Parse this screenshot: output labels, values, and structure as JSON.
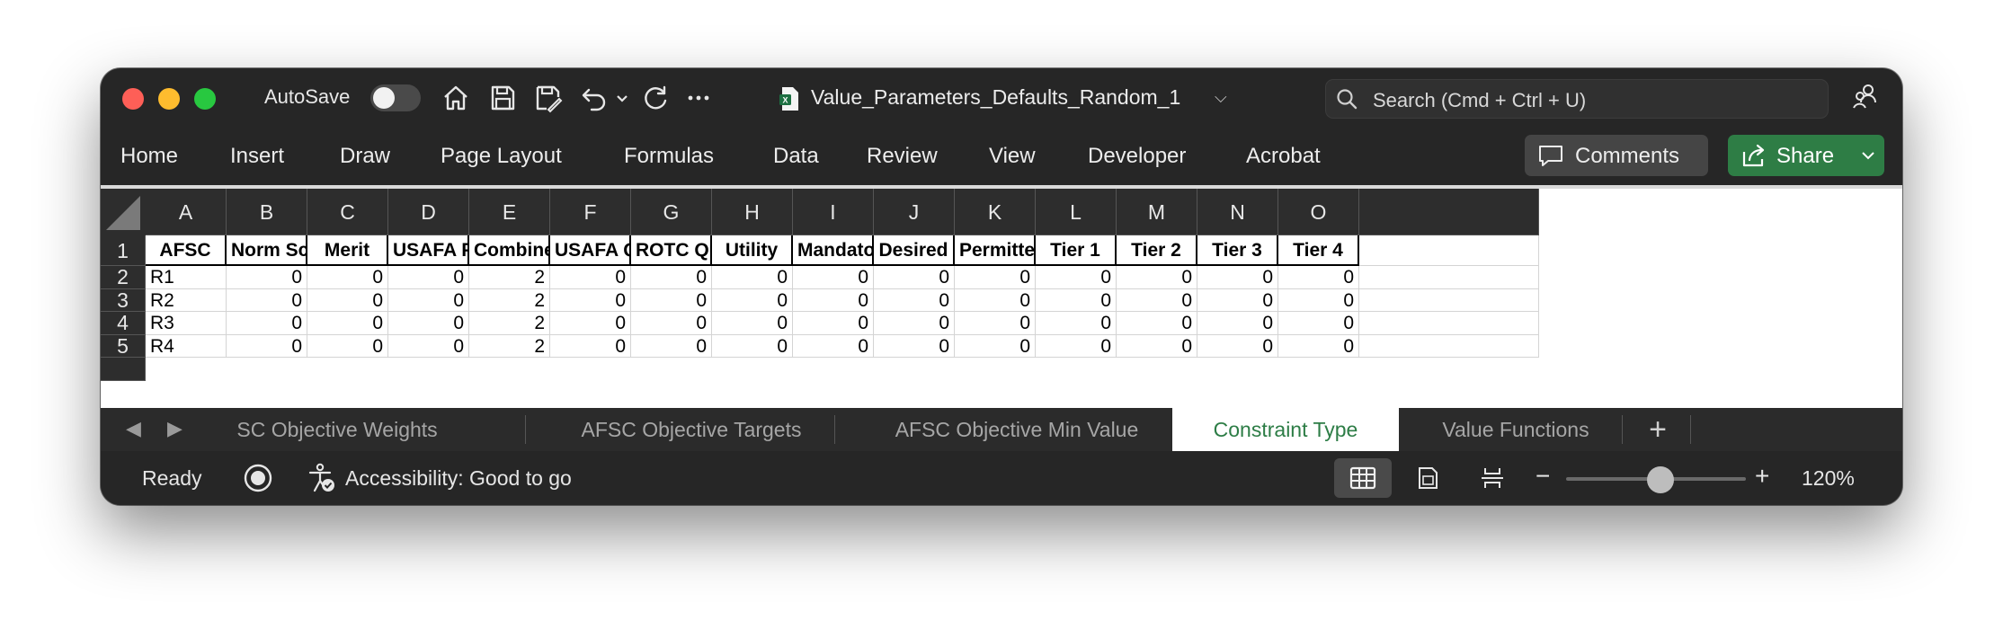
{
  "titlebar": {
    "autosave_label": "AutoSave",
    "autosave_on": false,
    "document_title": "Value_Parameters_Defaults_Random_1",
    "search_placeholder": "Search (Cmd + Ctrl + U)"
  },
  "ribbon": {
    "tabs": [
      "Home",
      "Insert",
      "Draw",
      "Page Layout",
      "Formulas",
      "Data",
      "Review",
      "View",
      "Developer",
      "Acrobat"
    ],
    "comments_label": "Comments",
    "share_label": "Share"
  },
  "grid": {
    "columns": [
      "A",
      "B",
      "C",
      "D",
      "E",
      "F",
      "G",
      "H",
      "I",
      "J",
      "K",
      "L",
      "M",
      "N",
      "O"
    ],
    "rows": [
      "1",
      "2",
      "3",
      "4",
      "5"
    ],
    "header_row": [
      "AFSC",
      "Norm Score",
      "Merit",
      "USAFA Proportion",
      "Combined Quota",
      "USAFA Quota",
      "ROTC Quota",
      "Utility",
      "Mandatory",
      "Desired",
      "Permitted",
      "Tier 1",
      "Tier 2",
      "Tier 3",
      "Tier 4"
    ],
    "data_rows": [
      [
        "R1",
        "0",
        "0",
        "0",
        "2",
        "0",
        "0",
        "0",
        "0",
        "0",
        "0",
        "0",
        "0",
        "0",
        "0"
      ],
      [
        "R2",
        "0",
        "0",
        "0",
        "2",
        "0",
        "0",
        "0",
        "0",
        "0",
        "0",
        "0",
        "0",
        "0",
        "0"
      ],
      [
        "R3",
        "0",
        "0",
        "0",
        "2",
        "0",
        "0",
        "0",
        "0",
        "0",
        "0",
        "0",
        "0",
        "0",
        "0"
      ],
      [
        "R4",
        "0",
        "0",
        "0",
        "2",
        "0",
        "0",
        "0",
        "0",
        "0",
        "0",
        "0",
        "0",
        "0",
        "0"
      ]
    ]
  },
  "sheets": {
    "tabs": [
      "AFSC Objective Weights",
      "AFSC Objective Targets",
      "AFSC Objective Min Value",
      "Constraint Type",
      "Value Functions"
    ],
    "active": "Constraint Type",
    "add_label": "+"
  },
  "statusbar": {
    "ready_label": "Ready",
    "accessibility_label": "Accessibility: Good to go",
    "zoom_label": "120%",
    "zoom_minus": "−",
    "zoom_plus": "+"
  },
  "colors": {
    "share_green": "#2e7d45",
    "active_tab_text": "#2d7d46",
    "chrome_dark": "#262626"
  }
}
